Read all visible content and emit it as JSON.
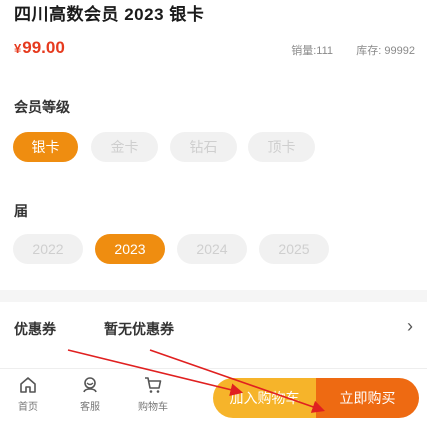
{
  "product": {
    "title": "四川高数会员 2023 银卡",
    "currency": "¥",
    "price": "99.00",
    "sales": "销量:111",
    "stock": "库存: 99992"
  },
  "tier": {
    "label": "会员等级",
    "options": [
      "银卡",
      "金卡",
      "钻石",
      "顶卡"
    ],
    "selected": "银卡"
  },
  "cohort": {
    "label": "届",
    "options": [
      "2022",
      "2023",
      "2024",
      "2025"
    ],
    "selected": "2023"
  },
  "coupon": {
    "label": "优惠券",
    "value": "暂无优惠券"
  },
  "bottom_nav": {
    "home": "首页",
    "service": "客服",
    "cart": "购物车"
  },
  "actions": {
    "add_to_cart": "加入购物车",
    "buy_now": "立即购买"
  },
  "colors": {
    "accent": "#ef8d10",
    "price": "#e63a1e",
    "cart_button": "#f6b42a",
    "buy_button": "#ee6a12",
    "annotation_arrow": "#e02020"
  }
}
